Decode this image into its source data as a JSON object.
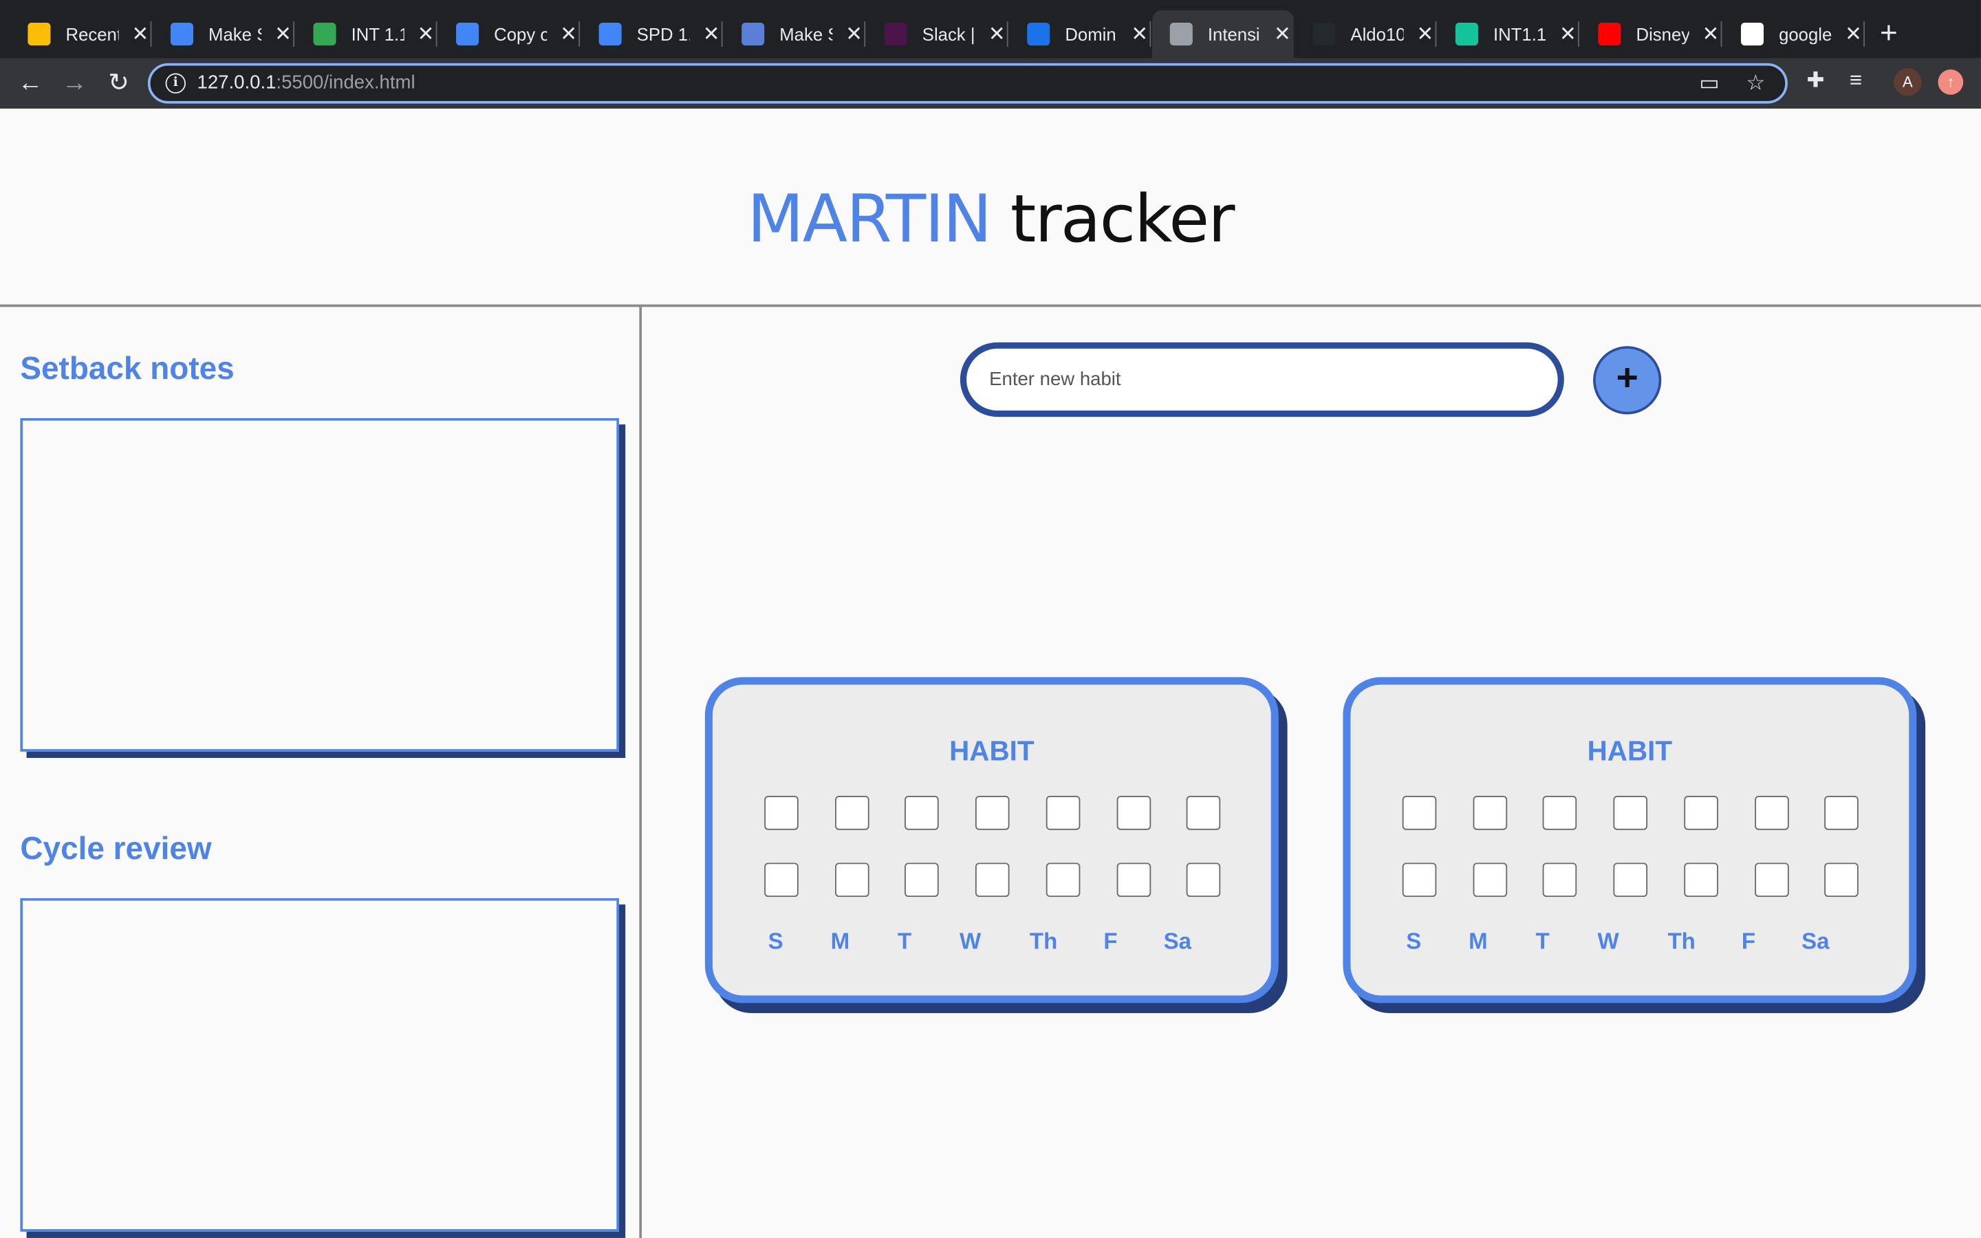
{
  "browser": {
    "tabs": [
      {
        "label": "Recent",
        "icon": "google-drive-icon",
        "color": "#fbbc04"
      },
      {
        "label": "Make S",
        "icon": "calendar-icon",
        "color": "#4285f4"
      },
      {
        "label": "INT 1.1",
        "icon": "bar-chart-icon",
        "color": "#34a853"
      },
      {
        "label": "Copy o",
        "icon": "google-docs-icon",
        "color": "#4285f4"
      },
      {
        "label": "SPD 1.",
        "icon": "google-docs-icon",
        "color": "#4285f4"
      },
      {
        "label": "Make S",
        "icon": "diamond-icon",
        "color": "#5b7fd6"
      },
      {
        "label": "Slack |",
        "icon": "slack-icon",
        "color": "#4a154b"
      },
      {
        "label": "Domin",
        "icon": "circle-icon",
        "color": "#1a73e8"
      },
      {
        "label": "Intensi",
        "icon": "globe-icon",
        "color": "#9aa0a6",
        "active": true
      },
      {
        "label": "Aldo10",
        "icon": "github-icon",
        "color": "#24292e"
      },
      {
        "label": "INT1.1",
        "icon": "grammarly-icon",
        "color": "#15c39a"
      },
      {
        "label": "Disney",
        "icon": "youtube-icon",
        "color": "#ff0000"
      },
      {
        "label": "google",
        "icon": "google-icon",
        "color": "#ffffff"
      }
    ],
    "url_host": "127.0.0.1",
    "url_rest": ":5500/index.html",
    "avatar_initial": "A"
  },
  "page": {
    "title_first": "MARTIN",
    "title_rest": " tracker",
    "setback_title": "Setback notes",
    "cycle_title": "Cycle review",
    "habit_placeholder": "Enter new habit",
    "add_label": "+"
  },
  "cards": [
    {
      "title": "HABIT",
      "days": [
        "S",
        "M",
        "T",
        "W",
        "Th",
        "F",
        "Sa"
      ]
    },
    {
      "title": "HABIT",
      "days": [
        "S",
        "M",
        "T",
        "W",
        "Th",
        "F",
        "Sa"
      ]
    }
  ],
  "colors": {
    "accent": "#4f84e6",
    "accent_dark": "#273f77"
  }
}
